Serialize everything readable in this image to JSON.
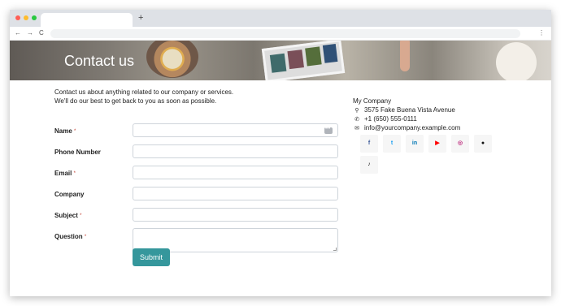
{
  "browser": {
    "new_tab_glyph": "+",
    "back_glyph": "←",
    "forward_glyph": "→",
    "reload_glyph": "C",
    "menu_glyph": "⋮",
    "traffic_lights": {
      "close": "#ff5f57",
      "minimize": "#febc2e",
      "maximize": "#28c840"
    }
  },
  "hero": {
    "title": "Contact us"
  },
  "intro": {
    "line1": "Contact us about anything related to our company or services.",
    "line2": "We'll do our best to get back to you as soon as possible."
  },
  "form": {
    "required_marker": "*",
    "fields": [
      {
        "label": "Name",
        "required": true,
        "value": ""
      },
      {
        "label": "Phone Number",
        "required": false,
        "value": ""
      },
      {
        "label": "Email",
        "required": true,
        "value": ""
      },
      {
        "label": "Company",
        "required": false,
        "value": ""
      },
      {
        "label": "Subject",
        "required": true,
        "value": ""
      },
      {
        "label": "Question",
        "required": true,
        "value": ""
      }
    ],
    "submit_label": "Submit",
    "accent_color": "#35979c"
  },
  "company": {
    "name": "My Company",
    "address": "3575 Fake Buena Vista Avenue",
    "phone": "+1 (650) 555-0111",
    "email": "info@yourcompany.example.com",
    "icons": {
      "address": "map-marker-icon",
      "phone": "phone-icon",
      "email": "envelope-icon"
    }
  },
  "social": [
    {
      "name": "facebook",
      "glyph": "f",
      "color": "#3b5998"
    },
    {
      "name": "twitter",
      "glyph": "t",
      "color": "#1da1f2"
    },
    {
      "name": "linkedin",
      "glyph": "in",
      "color": "#0077b5"
    },
    {
      "name": "youtube",
      "glyph": "▶",
      "color": "#ff0000"
    },
    {
      "name": "instagram",
      "glyph": "◎",
      "color": "#c13584"
    },
    {
      "name": "github",
      "glyph": "●",
      "color": "#111111"
    },
    {
      "name": "tiktok",
      "glyph": "♪",
      "color": "#111111"
    }
  ]
}
